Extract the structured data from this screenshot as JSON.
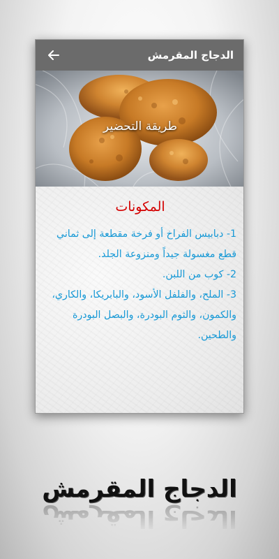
{
  "app_bar": {
    "title": "الدجاج المقرمش",
    "back_icon": "arrow-left-icon"
  },
  "hero": {
    "caption": "طريقة التحضير"
  },
  "content": {
    "heading": "المكونات",
    "ingredients": [
      "1- دبابيس الفراخ أو فرخة مقطعة إلى ثماني قطع مغسولة جيداً ومنزوعة الجلد.",
      "2- كوب من اللبن.",
      "3- الملح، والفلفل الأسود، والبابريكا، والكاري، والكمون، والثوم البودرة، والبصل البودرة والطحين."
    ]
  },
  "footer": {
    "title": "الدجاج المقرمش"
  },
  "colors": {
    "app_bar": "#6b6b6b",
    "heading": "#d40000",
    "ingredient_text": "#1799d6"
  }
}
